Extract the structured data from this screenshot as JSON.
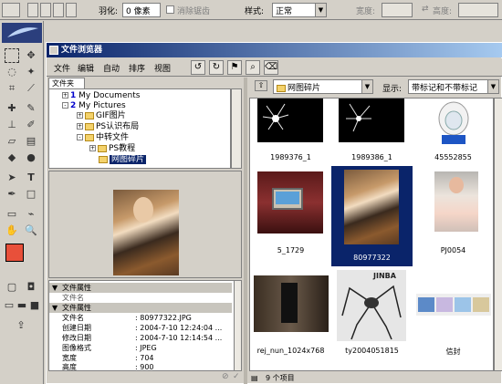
{
  "options_bar": {
    "feather_label": "羽化:",
    "feather_value": "0 像素",
    "antialias_label": "消除锯齿",
    "style_label": "样式:",
    "style_value": "正常",
    "width_label": "宽度:",
    "height_label": "高度:"
  },
  "window": {
    "title": "文件浏览器",
    "menus": [
      "文件",
      "编辑",
      "自动",
      "排序",
      "视图"
    ]
  },
  "tree": {
    "tab_label": "文件夹",
    "items": [
      {
        "num": "1",
        "label": "My Documents"
      },
      {
        "num": "2",
        "label": "My Pictures"
      },
      {
        "label": "GIF图片"
      },
      {
        "label": "PS认识布局"
      },
      {
        "label": "中转文件"
      },
      {
        "label": "PS教程"
      },
      {
        "label": "网图碎片"
      }
    ]
  },
  "metadata": {
    "section1": "文件属性",
    "section1_sub": "文件名",
    "section2": "文件属性",
    "rows": [
      {
        "key": "文件名",
        "value": ": 80977322.JPG"
      },
      {
        "key": "创建日期",
        "value": ": 2004-7-10 12:24:04 ..."
      },
      {
        "key": "修改日期",
        "value": ": 2004-7-10 12:14:54 ..."
      },
      {
        "key": "图像格式",
        "value": ": JPEG"
      },
      {
        "key": "宽度",
        "value": ": 704"
      },
      {
        "key": "高度",
        "value": ": 900"
      }
    ]
  },
  "right_pane": {
    "folder_value": "网图碎片",
    "display_label": "显示:",
    "display_value": "带标记和不带标记",
    "status": "9 个项目"
  },
  "thumbnails": [
    {
      "caption": "1989376_1"
    },
    {
      "caption": "1989386_1"
    },
    {
      "caption": "45552855"
    },
    {
      "caption": "5_1729"
    },
    {
      "caption": "80977322",
      "selected": true
    },
    {
      "caption": "PJ0054"
    },
    {
      "caption": "rej_nun_1024x768"
    },
    {
      "caption": "ty2004051815",
      "overlay": "JINBA"
    },
    {
      "caption": "信封"
    }
  ],
  "colors": {
    "title_bar": "#0a246a",
    "selection": "#0a246a",
    "foreground_swatch": "#e8503a",
    "background_swatch": "#ffffff"
  }
}
